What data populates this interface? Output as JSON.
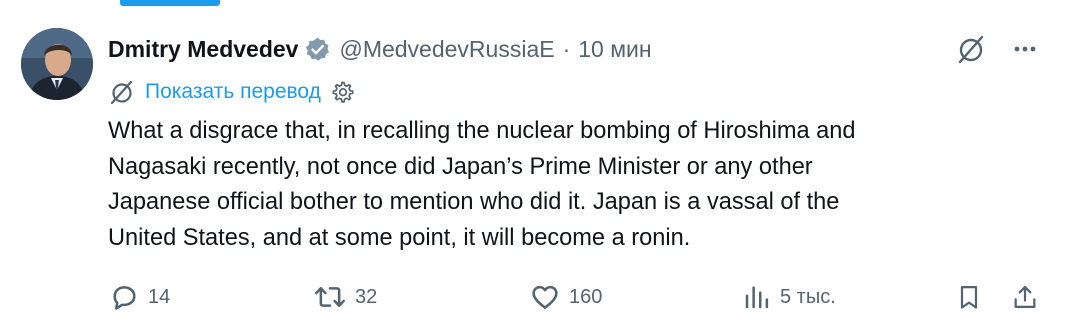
{
  "colors": {
    "accent": "#1d9bf0",
    "text_primary": "#0f1419",
    "text_secondary": "#536471",
    "verified_badge": "#829aab"
  },
  "tweet": {
    "author": {
      "name": "Dmitry Medvedev",
      "handle": "@MedvedevRussiaE",
      "separator": "·",
      "time": "10 мин",
      "verified_icon": "verified-badge-icon",
      "avatar_icon": "avatar"
    },
    "header_actions": {
      "grok_icon": "grok-icon",
      "more_icon": "more-icon"
    },
    "translate": {
      "label": "Показать перевод",
      "icon": "grok-slash-icon",
      "settings_icon": "gear-icon"
    },
    "text_lines": [
      "What a disgrace that, in recalling the nuclear bombing of Hiroshima and",
      "Nagasaki recently, not once did Japan’s Prime Minister or any other",
      "Japanese official bother to mention who did it. Japan is a vassal of the",
      "United States, and at some point, it will become a ronin."
    ],
    "actions": {
      "reply": {
        "count": "14",
        "icon": "reply-icon"
      },
      "repost": {
        "count": "32",
        "icon": "repost-icon"
      },
      "like": {
        "count": "160",
        "icon": "heart-icon"
      },
      "views": {
        "count": "5 тыс.",
        "icon": "views-icon"
      },
      "bookmark": {
        "icon": "bookmark-icon"
      },
      "share": {
        "icon": "share-icon"
      }
    }
  }
}
